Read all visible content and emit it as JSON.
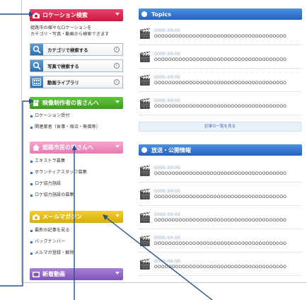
{
  "sidebar": {
    "location_search": {
      "title": "ロケーション検索",
      "icon": "camera-icon",
      "description": "姫路市の様々なロケーションを\nカテゴリ・写真・動画から検索できます",
      "buttons": [
        {
          "label": "カテゴリで検索する",
          "icon": "magnifier-icon"
        },
        {
          "label": "写真で検索する",
          "icon": "magnifier-icon"
        },
        {
          "label": "動画ライブラリ",
          "icon": "film-icon"
        }
      ]
    },
    "filmmakers": {
      "title": "映像制作者の皆さんへ",
      "items": [
        "ロケーション受付",
        "関連業者（食事・宿泊・無償等）"
      ]
    },
    "citizens": {
      "title": "姫路市民の皆さんへ",
      "items": [
        "エキストラ募集",
        "ボランティアスタッフ募集",
        "ロケ協力施設",
        "ロケ協力施設の募集"
      ]
    },
    "mail_magazine": {
      "title": "メールマガジン",
      "items": [
        "最新の記事を見る",
        "バックナンバー",
        "メルマガ登録・解除"
      ]
    },
    "new_videos": {
      "title": "新着動画"
    }
  },
  "topics": {
    "title": "Topics",
    "entries": [
      {
        "date": "0000-00-00",
        "text": "OOOOOOOOOOOOOOOOOOOOOOOOOOOOOOOOOOOOOO"
      },
      {
        "date": "0000-00-00",
        "text": "OOOOOOOOOOOOOOOOOOOOOOOOOOOOOOOOOOOOOO"
      },
      {
        "date": "0000-00-00",
        "text": "OOOOOOOOOOOOOOOOOOOOOOOOOOOOOOOOOOOOOO"
      },
      {
        "date": "0000-00-00",
        "text": "OOOOOOOOOOOOOOOOOOOOOOOOOOOOOOOOOOOOOO"
      }
    ],
    "more_label": "記事の一覧を見る"
  },
  "broadcast": {
    "title": "放送・公開情報",
    "entries": [
      {
        "date": "0000-00-00",
        "text": "OOOOOOOOOOOOOOOOOOOOOOOOOOOOOOOOOOOOOO"
      },
      {
        "date": "0000-00-00",
        "text": "OOOOOOOOOOOOOOOOOOOOOOOOOOOOOOOOOOOOOO"
      },
      {
        "date": "0000-00-00",
        "text": "OOOOOOOOOOOOOOOOOOOOOOOOOOOOOOOOOOOOOO"
      },
      {
        "date": "0000-00-00",
        "text": "OOOOOOOOOOOOOOOOOOOOOOOOOOOOOOOOOOOOOO"
      },
      {
        "date": "0000-00-00",
        "text": "OOOOOOOOOOOOOOOOOOOOOOOOOOOOOOOOOOOOOO"
      }
    ]
  },
  "colors": {
    "location_header": "#d42a52",
    "filmmakers_header": "#4caf2a",
    "citizens_header": "#ee8fc0",
    "mail_header": "#e3bd16",
    "video_header": "#9066c6",
    "right_header": "#3577d1",
    "callout_line": "#2b4f8e"
  }
}
